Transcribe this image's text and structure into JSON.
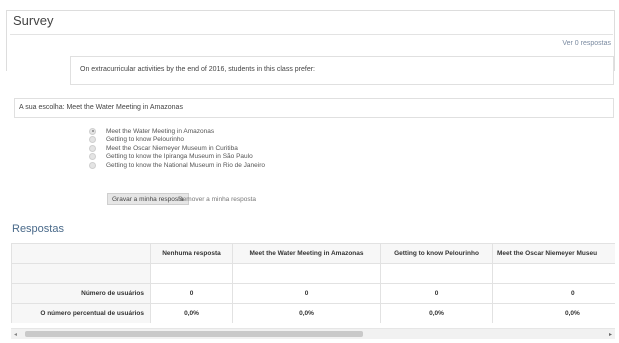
{
  "survey": {
    "title": "Survey",
    "view_responses_link": "Ver 0 respostas",
    "question": "On extracurricular activities by the end of 2016, students in this class prefer:",
    "your_choice": "A sua escolha: Meet the Water Meeting in Amazonas"
  },
  "options": [
    {
      "label": "Meet the Water Meeting in Amazonas",
      "checked": true
    },
    {
      "label": "Getting to know Pelourinho",
      "checked": false
    },
    {
      "label": "Meet the Oscar Niemeyer Museum in Curitiba",
      "checked": false
    },
    {
      "label": "Getting to know the Ipiranga Museum in São Paulo",
      "checked": false
    },
    {
      "label": "Getting to know the National Museum in Rio de Janeiro",
      "checked": false
    }
  ],
  "actions": {
    "save": "Gravar a minha resposta",
    "remove": "Remover a minha resposta"
  },
  "responses": {
    "heading": "Respostas",
    "columns": [
      "",
      "Nenhuma resposta",
      "Meet the Water Meeting in Amazonas",
      "Getting to know Pelourinho",
      "Meet the Oscar Niemeyer Museu"
    ],
    "rows": [
      {
        "label": "",
        "values": [
          "",
          "",
          "",
          ""
        ]
      },
      {
        "label": "Número de usuários",
        "values": [
          "0",
          "0",
          "0",
          "0"
        ]
      },
      {
        "label": "O número percentual de usuários",
        "values": [
          "0,0%",
          "0,0%",
          "0,0%",
          "0,0%"
        ]
      }
    ]
  },
  "scrollbar": {
    "left_arrow": "◂",
    "right_arrow": "▸"
  }
}
